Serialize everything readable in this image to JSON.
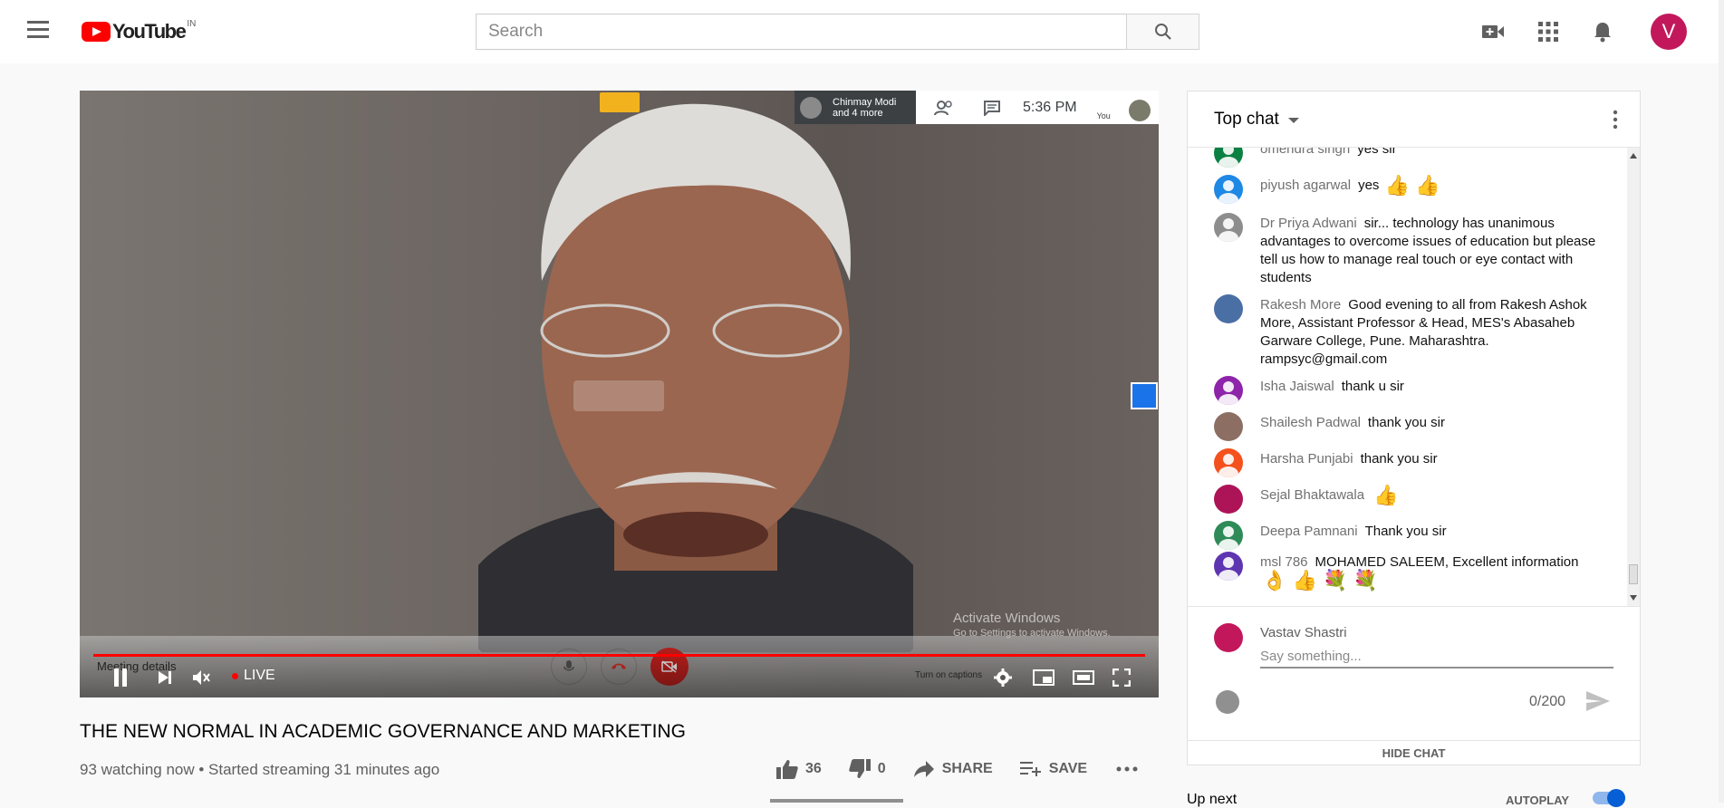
{
  "header": {
    "logo_text": "YouTube",
    "region": "IN",
    "search_placeholder": "Search",
    "avatar_letter": "V"
  },
  "player": {
    "meet_participants": "Chinmay Modi and 4 more",
    "meet_time": "5:36  PM",
    "meet_self_label": "You",
    "meeting_details": "Meeting details",
    "live_label": "LIVE",
    "captions_label": "Turn on captions",
    "activate_title": "Activate Windows",
    "activate_sub": "Go to Settings to activate Windows."
  },
  "video": {
    "title": "THE NEW NORMAL IN ACADEMIC GOVERNANCE AND MARKETING",
    "meta": "93 watching now • Started streaming 31 minutes ago",
    "likes": "36",
    "dislikes": "0",
    "share_label": "SHARE",
    "save_label": "SAVE"
  },
  "chat": {
    "header": "Top chat",
    "messages": [
      {
        "author": "omendra singh",
        "text": "yes sir",
        "emoji": "",
        "color": "#0b8043"
      },
      {
        "author": "piyush agarwal",
        "text": "yes",
        "emoji": "👍 👍",
        "color": "#1e88e5"
      },
      {
        "author": "Dr Priya Adwani",
        "text": "sir... technology has unanimous advantages to overcome issues of education but please tell us how to manage real touch or eye contact with students",
        "emoji": "",
        "color": "#8d8d8d"
      },
      {
        "author": "Rakesh More",
        "text": "Good evening to all from Rakesh Ashok More, Assistant Professor & Head, MES's Abasaheb Garware College, Pune. Maharashtra. rampsyc@gmail.com",
        "emoji": "",
        "color": "#4a6fa5"
      },
      {
        "author": "Isha Jaiswal",
        "text": "thank u sir",
        "emoji": "",
        "color": "#8e24aa"
      },
      {
        "author": "Shailesh Padwal",
        "text": "thank you sir",
        "emoji": "",
        "color": "#8d6e63"
      },
      {
        "author": "Harsha Punjabi",
        "text": "thank you sir",
        "emoji": "",
        "color": "#f4511e"
      },
      {
        "author": "Sejal Bhaktawala",
        "text": "",
        "emoji": "👍",
        "color": "#ad1457"
      },
      {
        "author": "Deepa Pamnani",
        "text": "Thank you sir",
        "emoji": "",
        "color": "#2e8b57"
      },
      {
        "author": "msl 786",
        "text": "MOHAMED SALEEM, Excellent information",
        "emoji": "👌 👍 💐 💐",
        "color": "#5e35b1"
      }
    ],
    "composer_name": "Vastav Shastri",
    "composer_placeholder": "Say something...",
    "char_count": "0/200",
    "hide_chat": "HIDE CHAT"
  },
  "up_next": {
    "label": "Up next",
    "autoplay": "AUTOPLAY",
    "autoplay_on": true
  },
  "colors": {
    "brand_red": "#ff0000",
    "link_blue": "#065fd4",
    "user_avatar": "#c2185b"
  }
}
